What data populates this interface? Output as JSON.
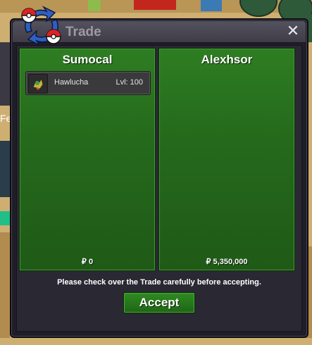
{
  "window": {
    "title": "Trade",
    "close_glyph": "✕"
  },
  "players": [
    {
      "name": "Sumocal",
      "money": "₽ 0",
      "items": [
        {
          "name": "Hawlucha",
          "level": "Lvl: 100",
          "icon": "hawlucha-icon"
        }
      ]
    },
    {
      "name": "Alexhsor",
      "money": "₽ 5,350,000",
      "items": []
    }
  ],
  "notice": "Please check over the Trade carefully before accepting.",
  "accept_label": "Accept",
  "background_fragment": "Fe",
  "colors": {
    "panel_green": "#2e7d22",
    "modal_bg": "#1f1d27",
    "accept_green": "#2f8a22"
  }
}
